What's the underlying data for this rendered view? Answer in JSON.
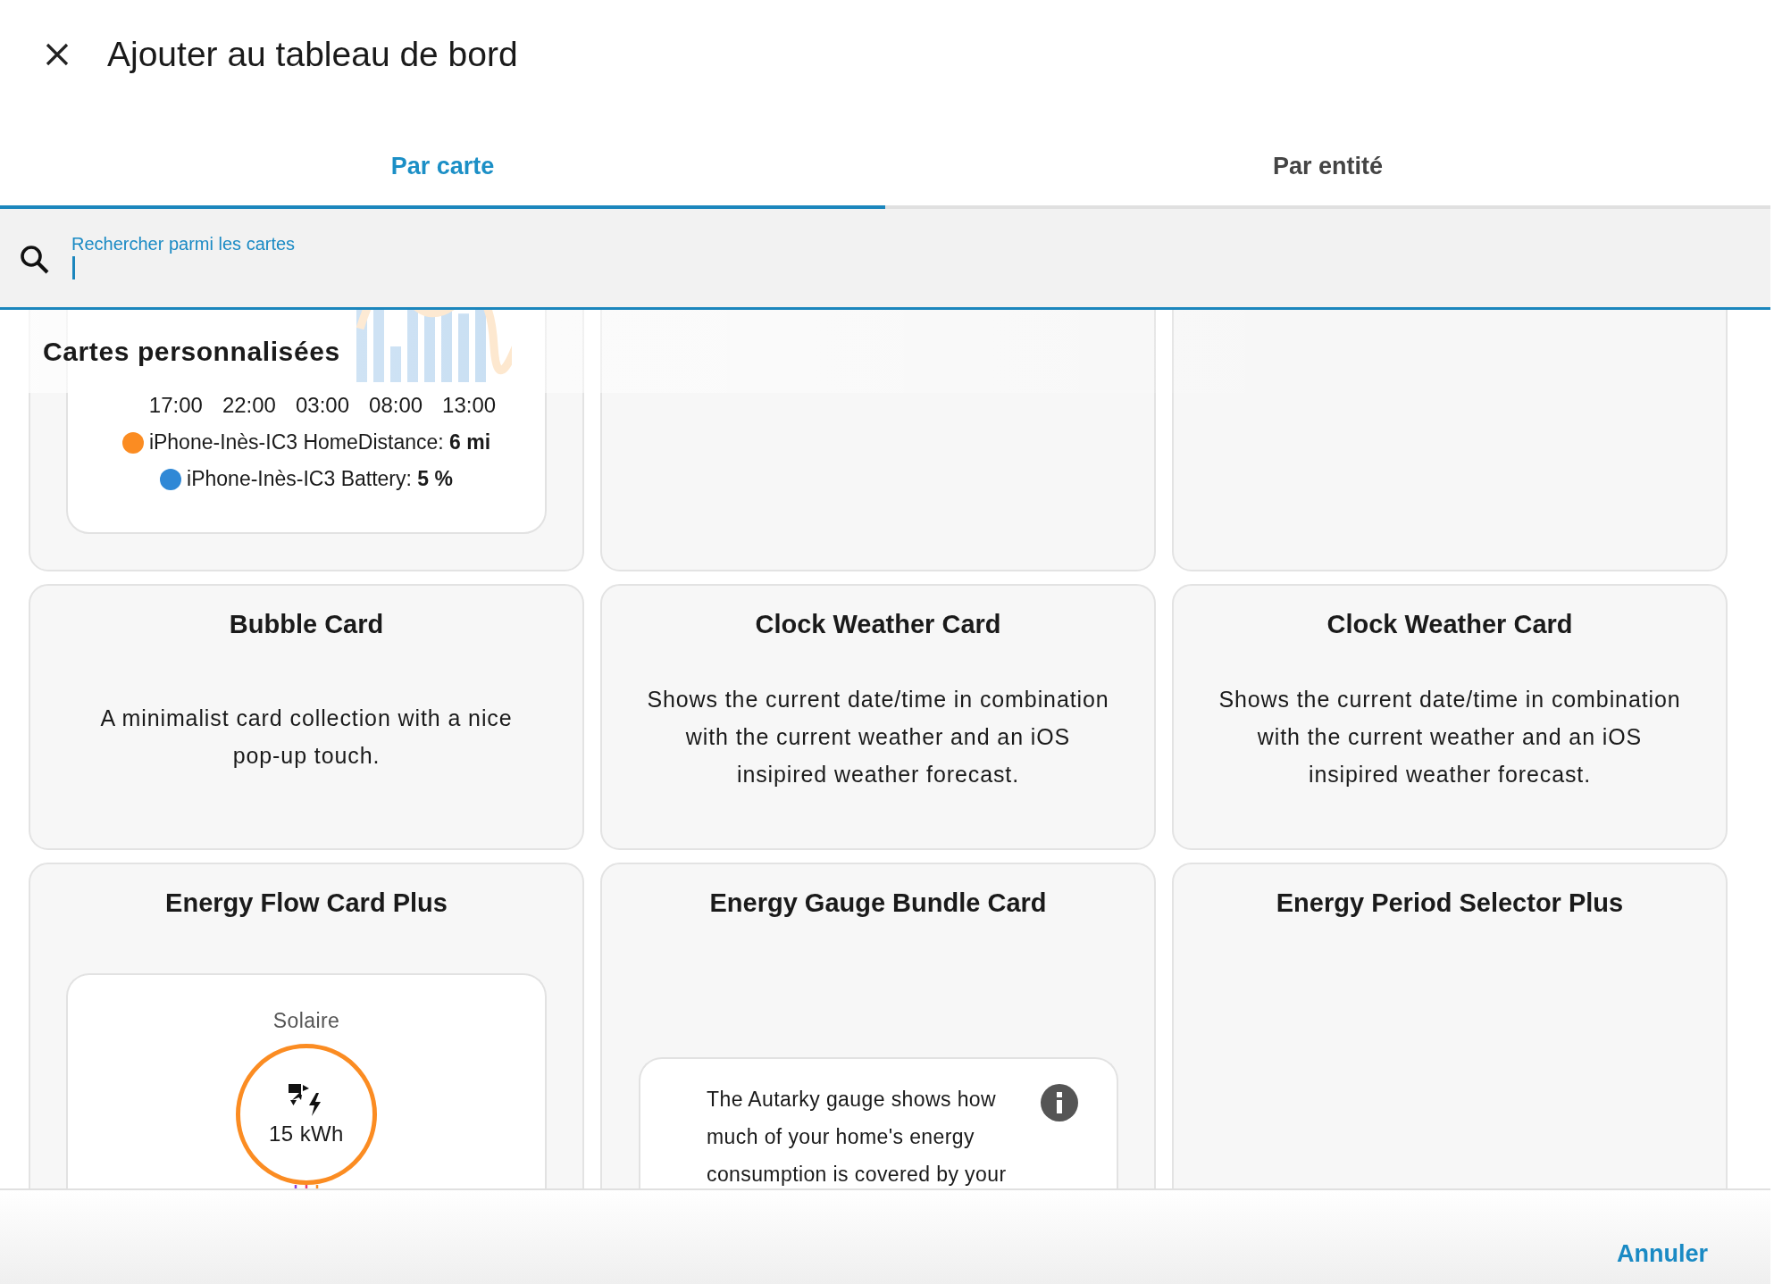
{
  "dialog": {
    "title": "Ajouter au tableau de bord"
  },
  "tabs": [
    {
      "label": "Par carte",
      "selected": true
    },
    {
      "label": "Par entité",
      "selected": false
    }
  ],
  "search": {
    "label": "Rechercher parmi les cartes"
  },
  "section_header": "Cartes personnalisées",
  "cards": [
    {
      "kind": "history",
      "time_labels": [
        "17:00",
        "22:00",
        "03:00",
        "08:00",
        "13:00"
      ],
      "legend": [
        {
          "text": "iPhone-Inès-IC3 HomeDistance: **6 mi**",
          "color": "#fb8c22"
        },
        {
          "text": "iPhone-Inès-IC3 Battery: **5 %**",
          "color": "#2f88d6"
        }
      ]
    },
    {
      "kind": "blank"
    },
    {
      "kind": "blank"
    },
    {
      "kind": "text",
      "title": "Bubble Card",
      "description": "A minimalist card collection with a nice pop-up touch."
    },
    {
      "kind": "text",
      "title": "Clock Weather Card",
      "description": "Shows the current date/time in combination with the current weather and an iOS insipired weather forecast."
    },
    {
      "kind": "text",
      "title": "Clock Weather Card",
      "description": "Shows the current date/time in combination with the current weather and an iOS insipired weather forecast."
    },
    {
      "kind": "energy_flow",
      "title": "Energy Flow Card Plus",
      "node_label": "Solaire",
      "node_value": "15 kWh"
    },
    {
      "kind": "gauge",
      "title": "Energy Gauge Bundle Card",
      "description": "The Autarky gauge shows how much of your home's energy consumption is covered by your"
    },
    {
      "kind": "title_only",
      "title": "Energy Period Selector Plus"
    }
  ],
  "footer": {
    "cancel": "Annuler"
  }
}
